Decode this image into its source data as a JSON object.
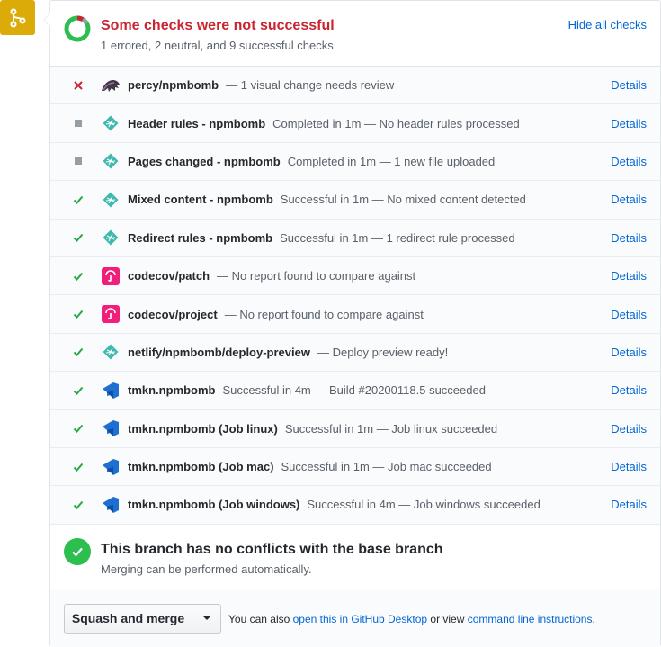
{
  "status": {
    "title": "Some checks were not successful",
    "summary": "1 errored, 2 neutral, and 9 successful checks",
    "hide_label": "Hide all checks"
  },
  "checks": [
    {
      "status": "error",
      "app": "percy",
      "name": "percy/npmbomb",
      "desc": "— 1 visual change needs review",
      "details": "Details"
    },
    {
      "status": "neutral",
      "app": "netlify",
      "name": "Header rules - npmbomb",
      "desc": "Completed in 1m — No header rules processed",
      "details": "Details"
    },
    {
      "status": "neutral",
      "app": "netlify",
      "name": "Pages changed - npmbomb",
      "desc": "Completed in 1m — 1 new file uploaded",
      "details": "Details"
    },
    {
      "status": "success",
      "app": "netlify",
      "name": "Mixed content - npmbomb",
      "desc": "Successful in 1m — No mixed content detected",
      "details": "Details"
    },
    {
      "status": "success",
      "app": "netlify",
      "name": "Redirect rules - npmbomb",
      "desc": "Successful in 1m — 1 redirect rule processed",
      "details": "Details"
    },
    {
      "status": "success",
      "app": "codecov",
      "name": "codecov/patch",
      "desc": "— No report found to compare against",
      "details": "Details"
    },
    {
      "status": "success",
      "app": "codecov",
      "name": "codecov/project",
      "desc": "— No report found to compare against",
      "details": "Details"
    },
    {
      "status": "success",
      "app": "netlify",
      "name": "netlify/npmbomb/deploy-preview",
      "desc": "— Deploy preview ready!",
      "details": "Details"
    },
    {
      "status": "success",
      "app": "azure",
      "name": "tmkn.npmbomb",
      "desc": "Successful in 4m — Build #20200118.5 succeeded",
      "details": "Details"
    },
    {
      "status": "success",
      "app": "azure",
      "name": "tmkn.npmbomb (Job linux)",
      "desc": "Successful in 1m — Job linux succeeded",
      "details": "Details"
    },
    {
      "status": "success",
      "app": "azure",
      "name": "tmkn.npmbomb (Job mac)",
      "desc": "Successful in 1m — Job mac succeeded",
      "details": "Details"
    },
    {
      "status": "success",
      "app": "azure",
      "name": "tmkn.npmbomb (Job windows)",
      "desc": "Successful in 4m — Job windows succeeded",
      "details": "Details"
    }
  ],
  "conflicts": {
    "title": "This branch has no conflicts with the base branch",
    "subtitle": "Merging can be performed automatically."
  },
  "footer": {
    "merge_label": "Squash and merge",
    "text_prefix": "You can also",
    "desktop_link": "open this in GitHub Desktop",
    "text_mid": "or view",
    "cli_link": "command line instructions",
    "text_suffix": "."
  },
  "colors": {
    "error": "#cb2431",
    "success": "#28a745",
    "neutral": "#959da5",
    "link": "#0366d6",
    "merge_badge": "#dbab09"
  },
  "icons": {
    "error": "x-icon",
    "neutral": "square-icon",
    "success": "check-icon",
    "merge": "git-merge-icon"
  }
}
